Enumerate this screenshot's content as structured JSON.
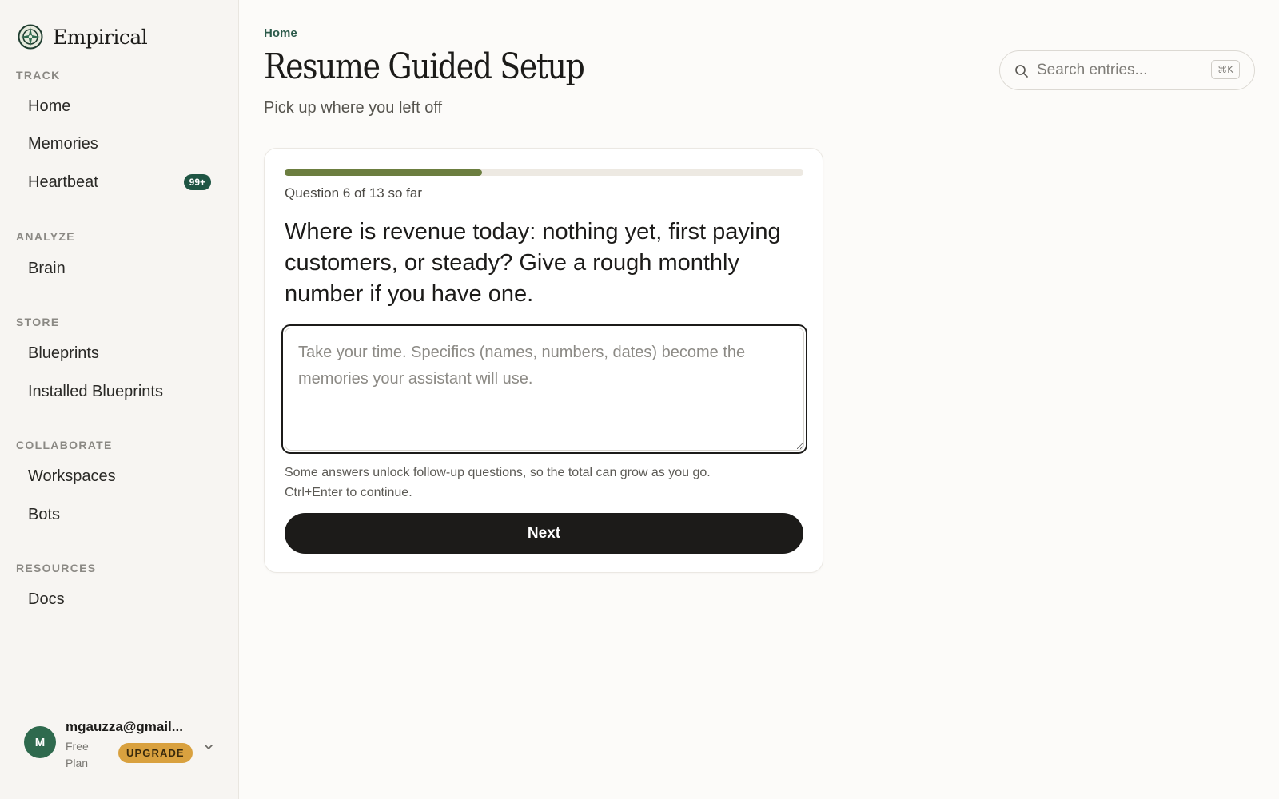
{
  "app": {
    "brand_name": "Empirical",
    "brand_icon": "compass-emblem-icon"
  },
  "sidebar": {
    "sections": [
      {
        "label": "TRACK",
        "items": [
          {
            "label": "Home"
          },
          {
            "label": "Memories"
          },
          {
            "label": "Heartbeat",
            "badge": "99+"
          }
        ]
      },
      {
        "label": "ANALYZE",
        "items": [
          {
            "label": "Brain"
          }
        ]
      },
      {
        "label": "STORE",
        "items": [
          {
            "label": "Blueprints"
          },
          {
            "label": "Installed Blueprints"
          }
        ]
      },
      {
        "label": "COLLABORATE",
        "items": [
          {
            "label": "Workspaces"
          },
          {
            "label": "Bots"
          }
        ]
      },
      {
        "label": "RESOURCES",
        "items": [
          {
            "label": "Docs"
          }
        ]
      }
    ],
    "user": {
      "avatar_initial": "M",
      "email": "mgauzza@gmail...",
      "plan": "Free Plan",
      "upgrade_label": "UPGRADE"
    }
  },
  "header": {
    "breadcrumb": "Home",
    "title": "Resume Guided Setup",
    "subtitle": "Pick up where you left off"
  },
  "search": {
    "placeholder": "Search entries...",
    "shortcut": "⌘K"
  },
  "setup": {
    "progress_fraction": 0.38,
    "progress_text": "Question 6 of 13 so far",
    "question": "Where is revenue today: nothing yet, first paying customers, or steady? Give a rough monthly number if you have one.",
    "answer_value": "",
    "answer_placeholder": "Take your time. Specifics (names, numbers, dates) become the memories your assistant will use.",
    "hint_line1": "Some answers unlock follow-up questions, so the total can grow as you go.",
    "hint_line2": "Ctrl+Enter to continue.",
    "next_label": "Next"
  },
  "colors": {
    "accent_green": "#1f5544",
    "progress_fill": "#6c7e40",
    "upgrade": "#d9a13f",
    "primary_button": "#1c1b19"
  }
}
